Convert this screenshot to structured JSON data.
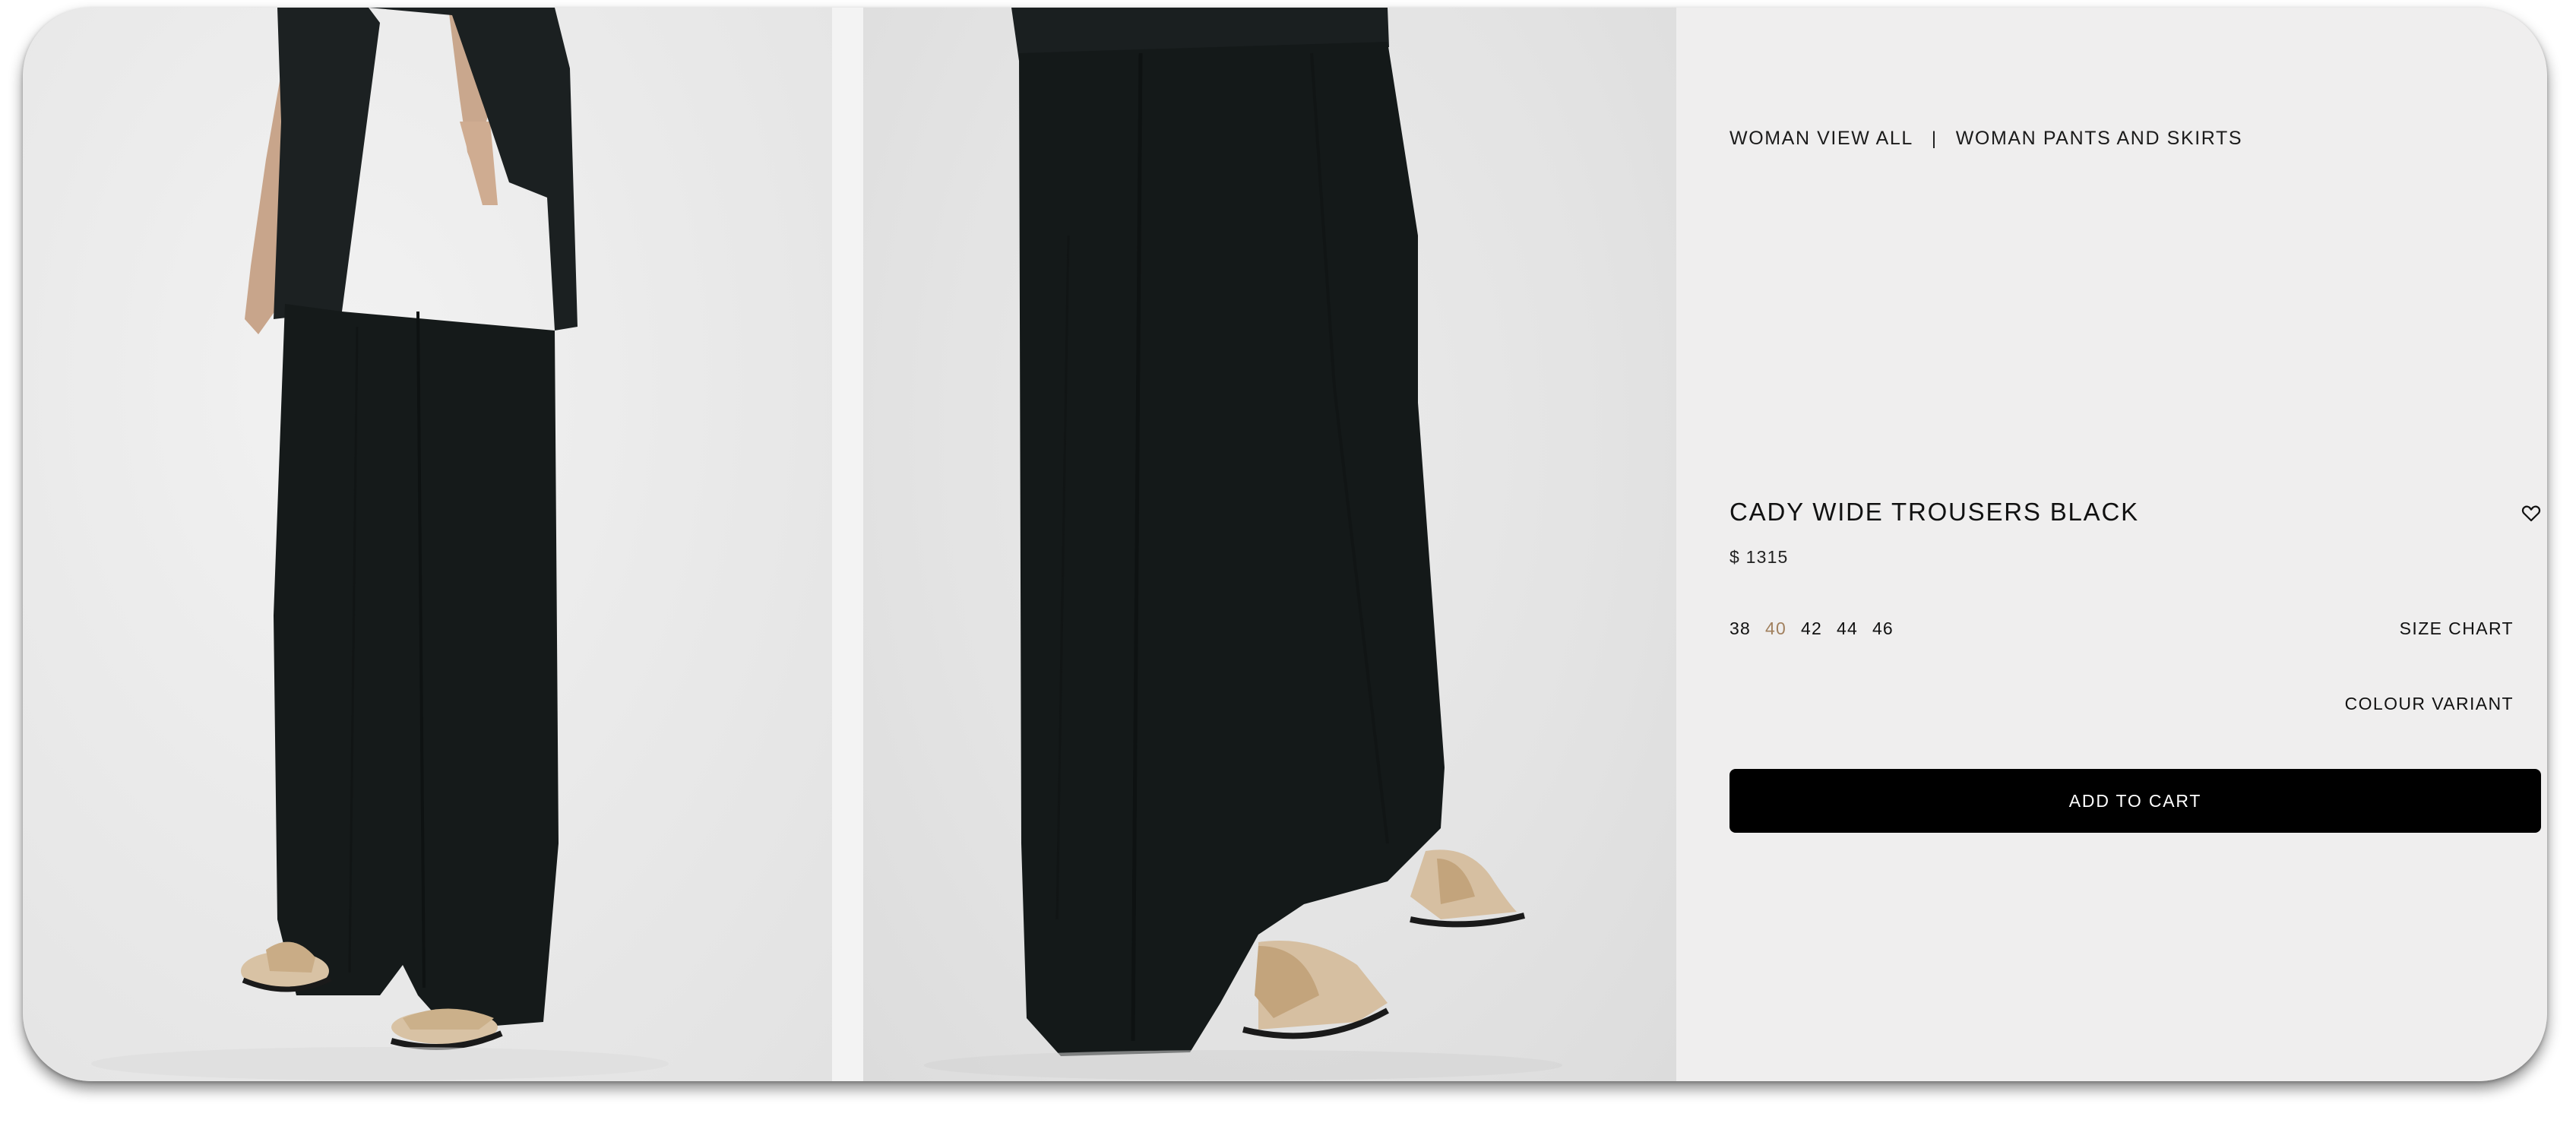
{
  "breadcrumb": {
    "items": [
      "WOMAN VIEW ALL",
      "WOMAN PANTS AND SKIRTS"
    ],
    "separator": "|"
  },
  "product": {
    "title": "CADY WIDE TROUSERS BLACK",
    "price": "$ 1315",
    "sizes": [
      "38",
      "40",
      "42",
      "44",
      "46"
    ],
    "selected_size": "40",
    "size_chart_label": "SIZE CHART",
    "colour_variant_label": "COLOUR VARIANT",
    "add_to_cart_label": "ADD TO CART"
  },
  "gallery": {
    "images": [
      "product-photo-side-view",
      "product-photo-front-view"
    ]
  },
  "icons": {
    "wishlist": "heart-icon"
  },
  "colors": {
    "panel_background": "#efeeee",
    "button_background": "#000000",
    "button_text": "#ffffff",
    "selected_size": "#a1805e",
    "garment": "#151a1a"
  }
}
